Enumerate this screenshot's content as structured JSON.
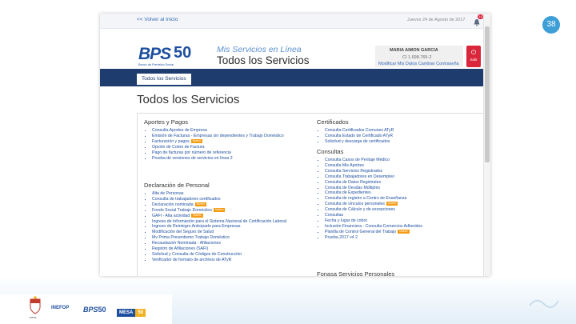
{
  "slide": {
    "number": "38"
  },
  "topbar": {
    "back_link": "<< Volver al Inicio",
    "date": "Jueves 24 de Agosto de 2017",
    "notifications_count": "14"
  },
  "header": {
    "logo_text": "BPS",
    "logo_anniversary": "50",
    "logo_tagline": "Banco de Previsión Social",
    "subtitle": "Mis Servicios en Línea",
    "title": "Todos los Servicios"
  },
  "user": {
    "name": "MARIA AIMON GARCIA",
    "id": "CI 1.698.765-2",
    "links": "Modificar Mis Datos    Cambiar Contraseña",
    "exit_label": "Salir"
  },
  "nav": {
    "active_tab": "Todos los Servicios"
  },
  "page": {
    "heading": "Todos los Servicios"
  },
  "new_badge": "Nuevo",
  "sections_left": [
    {
      "title": "Aportes y Pagos",
      "items": [
        "Consulta Aportes de Empresa",
        "Emisión de Facturas - Empresas sin dependientes y Trabajo Doméstico",
        "Facturación y pagos",
        "Opción de Cobro de Factura",
        "Pago de facturas por número de referencia",
        "Prueba de versiones de servicios en línea 2"
      ]
    },
    {
      "title": "Declaración de Personal",
      "items": [
        "Alta de Personas",
        "Consulta de trabajadores certificados",
        "Declaración nominada",
        "Fondo Social Trabajo Doméstico",
        "GAFI - Alta actividad",
        "Ingreso de Información para el Sistema Nacional de Certificación Laboral",
        "Ingreso de Reintegro Anticipado para Empresas",
        "Modificación del Seguro de Salud",
        "Mv Prima Presentismo Trabajo Doméstico",
        "Recaudación Nominada - Afiliaciones",
        "Registro de Afiliaciones (SAFI)",
        "Solicitud y Consulta de Códigos de Construcción",
        "Verificador de formato de archivos de ATyR"
      ]
    }
  ],
  "sections_right": [
    {
      "title": "Certificados",
      "items": [
        "Consulta Certificados Comunes ATyR",
        "Consulta Estado de Certificado ATyR",
        "Solicitud y descarga de certificados"
      ]
    },
    {
      "title": "Consultas",
      "items": [
        "Consulta Casos de Peritaje Médico",
        "Consulta Mis Aportes",
        "Consulta Servicios Registrados",
        "Consulta Trabajadores en Desempleo",
        "Consulta de Datos Registrales",
        "Consulta de Deudas Múltiples",
        "Consulta de Expedientes",
        "Consulta de registro a Centro de Enseñanza",
        "Consulta de vínculos personales",
        "Consulta de Cálculo y de excepciones",
        "Consultas",
        "Fecha y lugar de cobro",
        "Inclusión Financiera - Consulta Comercios Adheridos",
        "Planilla de Control General del Trabajo",
        "Prueba 2017 v4 2"
      ]
    },
    {
      "title": "Fonasa Servicios Personales",
      "items": []
    }
  ],
  "footer": {
    "crest_text": "MTSS",
    "inefop": "INEFOP",
    "bps": "BPS",
    "bps_fifty": "50",
    "mesa": "MESA",
    "mesa_num": "50"
  },
  "colors": {
    "navy": "#1e3c6e",
    "link": "#1d4e9f",
    "accent_red": "#d9263a",
    "badge_orange": "#f39c12",
    "slide_accent": "#3e9fd6"
  }
}
